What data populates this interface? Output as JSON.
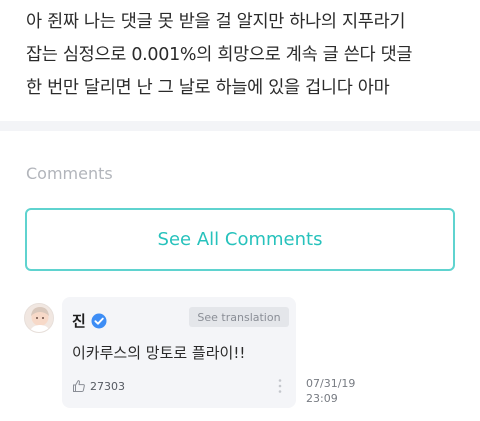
{
  "post": {
    "lines": [
      "아 쥔짜 나는 댓글 못 받을 걸 알지만 하나의 지푸라기",
      "잡는 심정으로 0.001%의 희망으로 계속 글 쓴다 댓글",
      "한 번만 달리면 난 그 날로 하늘에 있을 겁니다 아마"
    ]
  },
  "comments_section": {
    "heading": "Comments",
    "see_all_label": "See All Comments"
  },
  "comment": {
    "author": "진",
    "verified": true,
    "translate_label": "See translation",
    "body": "이카루스의 망토로 플라이!!",
    "likes": "27303",
    "date": "07/31/19",
    "time": "23:09"
  },
  "colors": {
    "accent": "#27c2bc",
    "verified_badge": "#3d8df5",
    "card_bg": "#f4f5f8"
  },
  "icons": [
    "verified-badge-icon",
    "thumbs-up-icon",
    "more-options-icon"
  ]
}
